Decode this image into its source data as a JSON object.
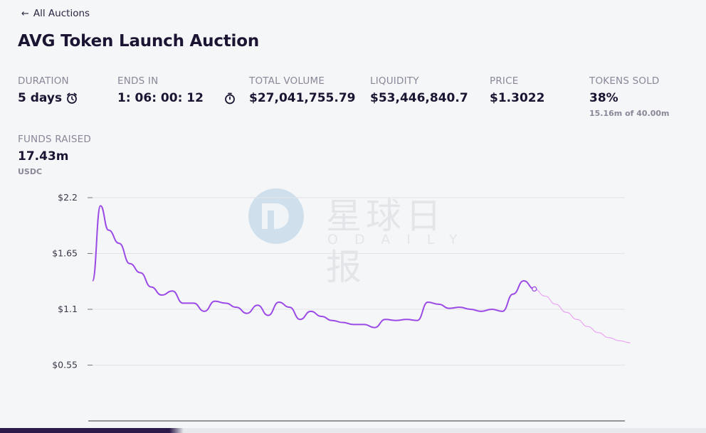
{
  "nav": {
    "back_label": "All Auctions"
  },
  "page": {
    "title": "AVG Token Launch Auction"
  },
  "stats": {
    "duration": {
      "label": "DURATION",
      "value": "5 days"
    },
    "ends_in": {
      "label": "ENDS IN",
      "value": "1: 06: 00: 12"
    },
    "total_volume": {
      "label": "TOTAL VOLUME",
      "value": "$27,041,755.79"
    },
    "liquidity": {
      "label": "LIQUIDITY",
      "value": "$53,446,840.7"
    },
    "price": {
      "label": "PRICE",
      "value": "$1.3022"
    },
    "tokens_sold": {
      "label": "TOKENS SOLD",
      "value": "38%",
      "sub": "15.16m of 40.00m"
    },
    "funds_raised": {
      "label": "FUNDS RAISED",
      "value": "17.43m",
      "sub": "USDC"
    }
  },
  "watermark": {
    "text_cn": "星球日报",
    "text_en": "ODAILY"
  },
  "icons": {
    "duration": "alarm-clock-icon",
    "ends_in": "stopwatch-icon",
    "back": "arrow-left-icon"
  },
  "colors": {
    "price_line": "#9b4ae6",
    "projection_line": "#eaa6f2",
    "accent_dark": "#2c1a4a"
  },
  "chart_data": {
    "type": "line",
    "y_tick_labels": [
      "$2.2",
      "$1.65",
      "$1.1",
      "$0.55"
    ],
    "y_ticks": [
      2.2,
      1.65,
      1.1,
      0.55
    ],
    "ylim": [
      0.0,
      2.2
    ],
    "x": [
      0,
      1.5,
      3,
      5,
      7,
      9,
      11,
      13,
      15,
      17,
      19,
      21,
      23,
      25,
      27,
      29,
      31,
      33,
      35,
      37,
      39,
      41,
      43,
      45,
      47,
      49,
      51,
      53,
      55,
      57,
      59,
      61,
      63,
      65,
      67,
      69,
      71,
      73,
      75,
      77,
      79,
      81,
      83,
      85,
      87,
      89,
      91,
      93,
      95,
      97,
      99,
      101
    ],
    "series": [
      {
        "values": [
          1.38,
          2.12,
          1.88,
          1.75,
          1.55,
          1.46,
          1.32,
          1.24,
          1.28,
          1.16,
          1.16,
          1.08,
          1.18,
          1.16,
          1.12,
          1.06,
          1.14,
          1.04,
          1.17,
          1.12,
          1.0,
          1.08,
          1.03,
          0.99,
          0.97,
          0.95,
          0.95,
          0.92,
          1.0,
          0.99,
          1.0,
          0.99,
          1.17,
          1.15,
          1.11,
          1.12,
          1.1,
          1.08,
          1.1,
          1.08,
          1.25,
          1.38,
          1.3
        ],
        "style": "solid"
      },
      {
        "values": [
          1.3,
          1.23,
          1.15,
          1.07,
          1.0,
          0.93,
          0.87,
          0.82,
          0.79,
          0.77,
          0.76
        ],
        "style": "projection"
      }
    ],
    "grid": true
  }
}
